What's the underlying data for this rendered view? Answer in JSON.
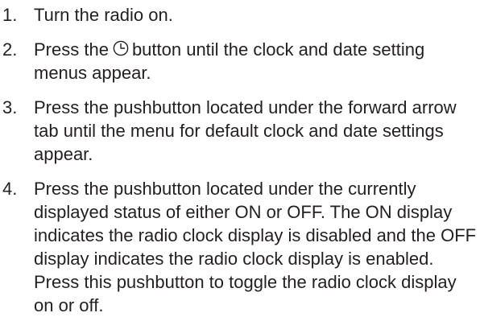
{
  "steps": [
    {
      "number": "1.",
      "text": "Turn the radio on."
    },
    {
      "number": "2.",
      "text_before_icon": "Press the",
      "icon": "clock-icon",
      "text_after_icon": "button until the clock and date setting menus appear."
    },
    {
      "number": "3.",
      "text": "Press the pushbutton located under the forward arrow tab until the menu for default clock and date settings appear."
    },
    {
      "number": "4.",
      "text": "Press the pushbutton located under the currently displayed status of either ON or OFF. The ON display indicates the radio clock display is disabled and the OFF display indicates the radio clock display is enabled. Press this pushbutton to toggle the radio clock display on or off."
    }
  ]
}
